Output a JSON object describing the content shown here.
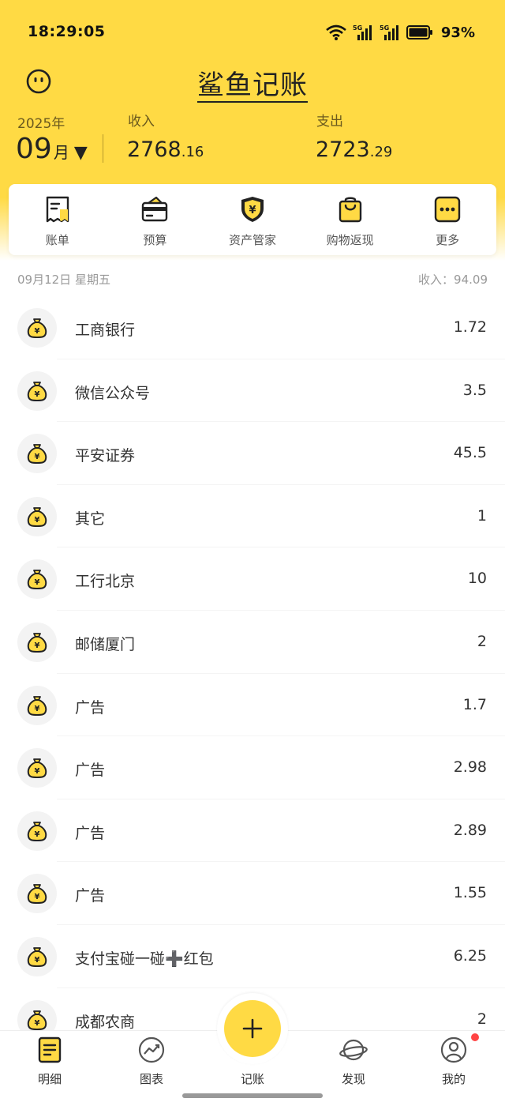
{
  "status": {
    "time": "18:29:05",
    "battery": "93%",
    "signal1": "5G",
    "signal2": "5G"
  },
  "app": {
    "title": "鲨鱼记账"
  },
  "summary": {
    "year": "2025年",
    "month": "09",
    "month_unit": "月",
    "caret": "▼",
    "income_label": "收入",
    "income_int": "2768",
    "income_dec": ".16",
    "expense_label": "支出",
    "expense_int": "2723",
    "expense_dec": ".29"
  },
  "tools": [
    {
      "label": "账单",
      "icon": "bill-icon"
    },
    {
      "label": "预算",
      "icon": "wallet-icon"
    },
    {
      "label": "资产管家",
      "icon": "shield-yuan-icon"
    },
    {
      "label": "购物返现",
      "icon": "shopping-bag-icon"
    },
    {
      "label": "更多",
      "icon": "more-icon"
    }
  ],
  "day": {
    "date": "09月12日 星期五",
    "income": "收入：94.09"
  },
  "entries": [
    {
      "name": "工商银行",
      "amount": "1.72"
    },
    {
      "name": "微信公众号",
      "amount": "3.5"
    },
    {
      "name": "平安证券",
      "amount": "45.5"
    },
    {
      "name": "其它",
      "amount": "1"
    },
    {
      "name": "工行北京",
      "amount": "10"
    },
    {
      "name": "邮储厦门",
      "amount": "2"
    },
    {
      "name": "广告",
      "amount": "1.7"
    },
    {
      "name": "广告",
      "amount": "2.98"
    },
    {
      "name": "广告",
      "amount": "2.89"
    },
    {
      "name": "广告",
      "amount": "1.55"
    },
    {
      "name": "支付宝碰一碰➕红包",
      "amount": "6.25"
    },
    {
      "name": "成都农商",
      "amount": "2"
    }
  ],
  "tabs": [
    {
      "label": "明细",
      "icon": "list-icon"
    },
    {
      "label": "图表",
      "icon": "chart-icon"
    },
    {
      "label": "记账",
      "icon": "plus-icon"
    },
    {
      "label": "发现",
      "icon": "planet-icon"
    },
    {
      "label": "我的",
      "icon": "person-icon"
    }
  ],
  "colors": {
    "brand": "#FFDA44",
    "text": "#333333",
    "badge": "#FF4444"
  }
}
